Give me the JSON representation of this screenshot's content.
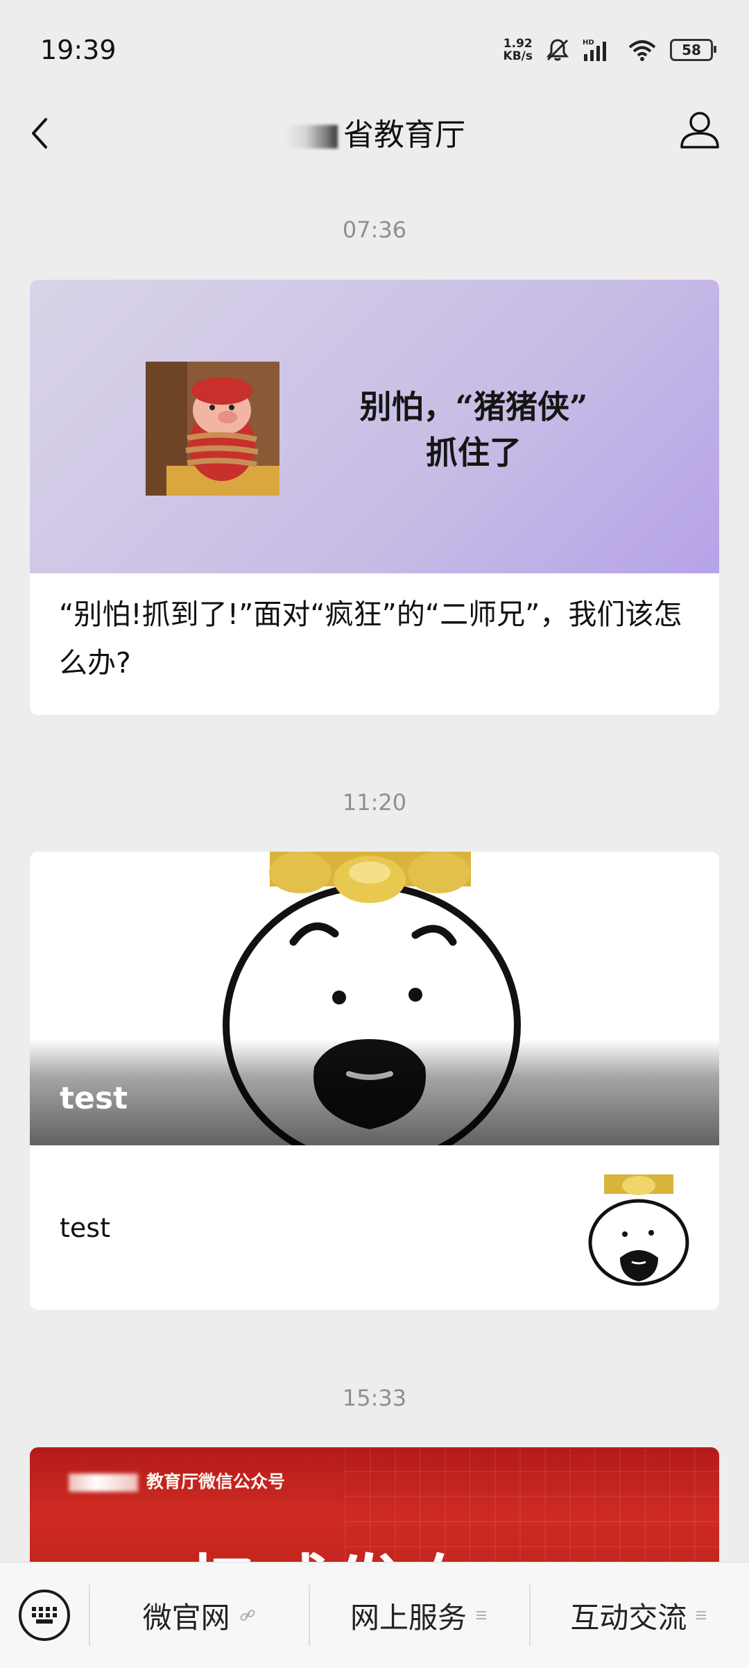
{
  "status_bar": {
    "time": "19:39",
    "net_speed_value": "1.92",
    "net_speed_unit": "KB/s",
    "battery": "58"
  },
  "nav": {
    "title_blurred": "",
    "title": "省教育厅"
  },
  "messages": [
    {
      "timestamp": "07:36",
      "cover_text_line1": "别怕，“猪猪侠”",
      "cover_text_line2": "抓住了",
      "title": "“别怕!抓到了!”面对“疯狂”的“二师兄”，我们该怎么办?"
    },
    {
      "timestamp": "11:20",
      "cover_title": "test",
      "subtitle": "test"
    },
    {
      "timestamp": "15:33",
      "header_text": "教育厅微信公众号",
      "big_text": "权威发布"
    }
  ],
  "bottom_menu": {
    "items": [
      {
        "label": "微官网",
        "icon": "link-icon"
      },
      {
        "label": "网上服务",
        "icon": "menu-lines-icon"
      },
      {
        "label": "互动交流",
        "icon": "menu-lines-icon"
      }
    ]
  },
  "colors": {
    "background": "#ededed",
    "card_bg": "#ffffff",
    "timestamp": "#8f8f8f",
    "red_banner": "#c2241d"
  }
}
